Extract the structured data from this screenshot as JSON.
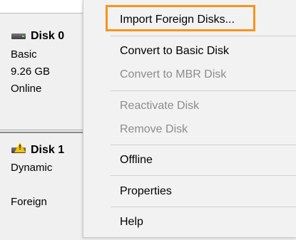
{
  "disks": [
    {
      "name": "Disk 0",
      "icon": "disk-drive-icon",
      "lines": [
        "Basic",
        "9.26 GB",
        "Online"
      ]
    },
    {
      "name": "Disk 1",
      "icon": "disk-drive-warning-icon",
      "lines": [
        "Dynamic",
        "",
        "Foreign"
      ]
    }
  ],
  "context_menu": {
    "items": [
      {
        "label": "Import Foreign Disks...",
        "enabled": true,
        "highlighted": true
      },
      {
        "label": "Convert to Basic Disk",
        "enabled": true
      },
      {
        "label": "Convert to MBR Disk",
        "enabled": false
      },
      {
        "label": "Reactivate Disk",
        "enabled": false
      },
      {
        "label": "Remove Disk",
        "enabled": false
      },
      {
        "label": "Offline",
        "enabled": true
      },
      {
        "label": "Properties",
        "enabled": true
      },
      {
        "label": "Help",
        "enabled": true
      }
    ]
  },
  "colors": {
    "highlight_border": "#f7941d",
    "disabled_text": "#8c8c8c",
    "warning_yellow": "#f2c200"
  }
}
